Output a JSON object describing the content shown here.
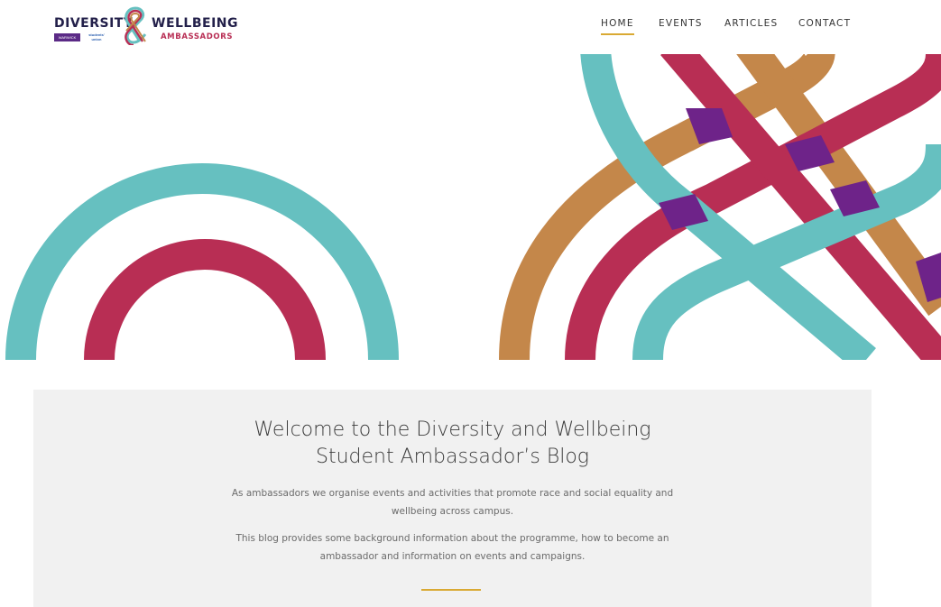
{
  "brand": {
    "word1": "DIVERSITY",
    "word2": "WELLBEING",
    "word3": "AMBASSADORS",
    "badge1": "WARWICK",
    "badge2": "students' union",
    "colors": {
      "navy": "#23204a",
      "teal": "#66c0c0",
      "crimson": "#b82e54",
      "ochre": "#c4874a",
      "purple": "#6e2389",
      "gold": "#d9a933"
    }
  },
  "nav": {
    "items": [
      {
        "label": "HOME",
        "active": true
      },
      {
        "label": "EVENTS",
        "active": false
      },
      {
        "label": "ARTICLES",
        "active": false
      },
      {
        "label": "CONTACT",
        "active": false
      }
    ]
  },
  "welcome": {
    "title_line1": "Welcome to the Diversity and Wellbeing",
    "title_line2": "Student Ambassador’s Blog",
    "paragraph1_line1": "As ambassadors we organise events and activities that promote race and social equality and",
    "paragraph1_line2": "wellbeing across campus.",
    "paragraph2_line1": "This blog provides some background information about the programme, how to become an",
    "paragraph2_line2": "ambassador and information on events and campaigns."
  }
}
